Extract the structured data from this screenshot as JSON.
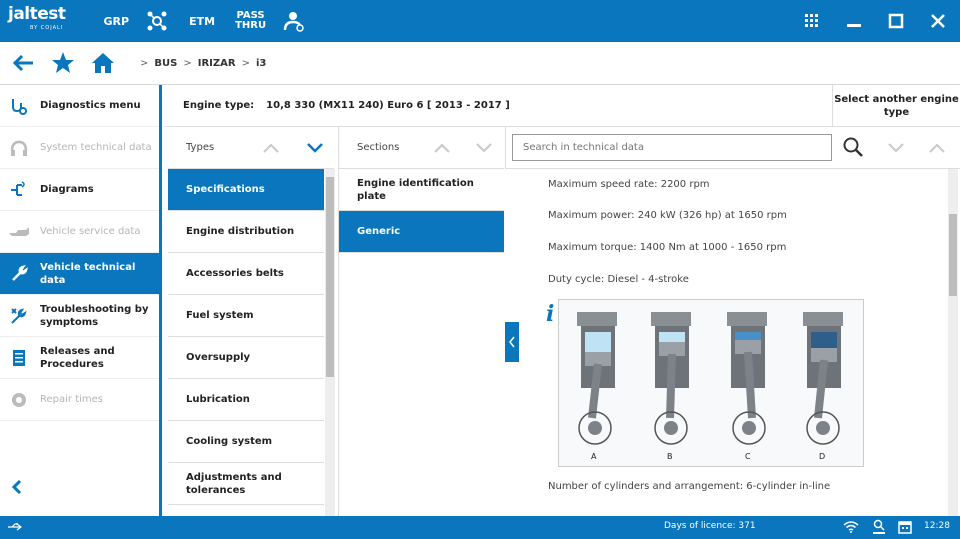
{
  "app": {
    "logo": "jaltest",
    "logo_sub": "BY COJALI",
    "top_buttons": [
      "GRP",
      "ETM"
    ],
    "pass_thru": [
      "PASS",
      "THRU"
    ]
  },
  "breadcrumb": [
    "BUS",
    "IRIZAR",
    "i3"
  ],
  "sidebar": {
    "items": [
      {
        "label": "Diagnostics menu",
        "icon": "diagnostics-icon",
        "state": "normal"
      },
      {
        "label": "System technical data",
        "icon": "system-data-icon",
        "state": "disabled"
      },
      {
        "label": "Diagrams",
        "icon": "diagrams-icon",
        "state": "normal"
      },
      {
        "label": "Vehicle service data",
        "icon": "service-data-icon",
        "state": "disabled"
      },
      {
        "label": "Vehicle technical data",
        "icon": "wrench-icon",
        "state": "active"
      },
      {
        "label": "Troubleshooting by symptoms",
        "icon": "troubleshooting-icon",
        "state": "normal"
      },
      {
        "label": "Releases and Procedures",
        "icon": "procedures-icon",
        "state": "normal"
      },
      {
        "label": "Repair times",
        "icon": "repair-times-icon",
        "state": "disabled"
      }
    ]
  },
  "engine": {
    "label": "Engine type:",
    "value": "10,8 330 (MX11 240) Euro 6 [ 2013 - 2017 ]",
    "select_other": "Select another engine type"
  },
  "types": {
    "header": "Types",
    "items": [
      "Specifications",
      "Engine distribution",
      "Accessories belts",
      "Fuel system",
      "Oversupply",
      "Lubrication",
      "Cooling system",
      "Adjustments and tolerances"
    ],
    "active_index": 0
  },
  "sections": {
    "header": "Sections",
    "items": [
      "Engine identification plate",
      "Generic"
    ],
    "active_index": 1
  },
  "search": {
    "placeholder": "Search in technical data"
  },
  "content": {
    "lines": [
      "Maximum speed rate: 2200 rpm",
      "Maximum power: 240 kW (326 hp) at 1650 rpm",
      "Maximum torque: 1400 Nm at 1000 - 1650 rpm",
      "Duty cycle: Diesel - 4-stroke"
    ],
    "after_diagram": "Number of cylinders and arrangement: 6-cylinder in-line",
    "diagram_labels": [
      "A",
      "B",
      "C",
      "D"
    ]
  },
  "status": {
    "licence": "Days of licence: 371",
    "time": "12:28"
  },
  "colors": {
    "brand_blue": "#0a76bd"
  }
}
